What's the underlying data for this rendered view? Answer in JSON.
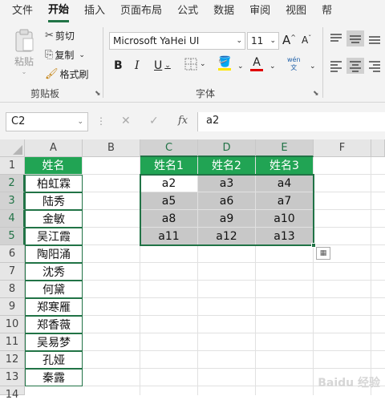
{
  "tabs": [
    "文件",
    "开始",
    "插入",
    "页面布局",
    "公式",
    "数据",
    "审阅",
    "视图",
    "帮"
  ],
  "clipboard": {
    "paste": "粘贴",
    "cut": "剪切",
    "copy": "复制",
    "painter": "格式刷",
    "label": "剪贴板"
  },
  "font": {
    "name": "Microsoft YaHei UI",
    "size": "11",
    "label": "字体",
    "grow": "A",
    "shrink": "A",
    "bold": "B",
    "italic": "I",
    "underline": "U",
    "phonetic": "wén\n文"
  },
  "formula_bar": {
    "name_box": "C2",
    "fx": "fx",
    "value": "a2"
  },
  "columns": [
    "A",
    "B",
    "C",
    "D",
    "E",
    "F"
  ],
  "rows": [
    "1",
    "2",
    "3",
    "4",
    "5",
    "6",
    "7",
    "8",
    "9",
    "10",
    "11",
    "12",
    "13",
    "14"
  ],
  "col_a": [
    "姓名",
    "柏虹霖",
    "陆秀",
    "金敏",
    "吴江霞",
    "陶阳涌",
    "沈秀",
    "何黛",
    "郑寒雁",
    "郑香薇",
    "吴易梦",
    "孔娅",
    "秦露"
  ],
  "table": {
    "headers": [
      "姓名1",
      "姓名2",
      "姓名3"
    ],
    "rows": [
      [
        "a2",
        "a3",
        "a4"
      ],
      [
        "a5",
        "a6",
        "a7"
      ],
      [
        "a8",
        "a9",
        "a10"
      ],
      [
        "a11",
        "a12",
        "a13"
      ]
    ]
  },
  "accent": "#217346",
  "header_fill": "#21a454",
  "selection_fill": "#c8c8c8",
  "watermark": "Baidu 经验"
}
